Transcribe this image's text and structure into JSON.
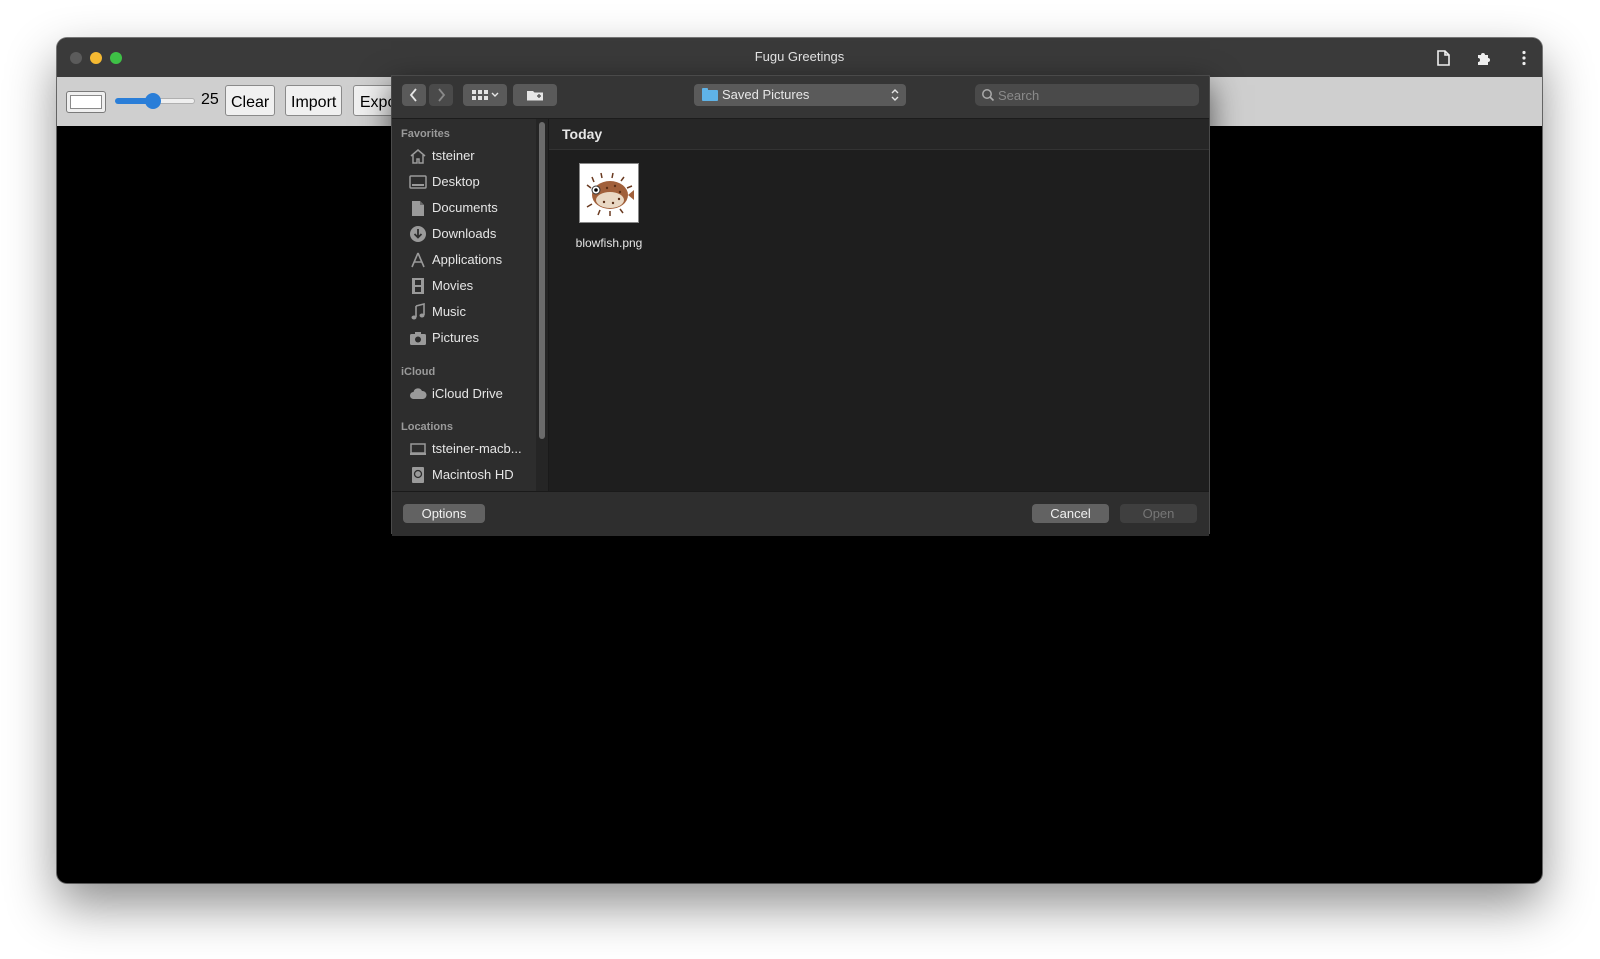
{
  "window": {
    "title": "Fugu Greetings"
  },
  "toolbar": {
    "color_value": "#ffffff",
    "brush_size_value": 25,
    "brush_size_label": "25",
    "clear_label": "Clear",
    "import_label": "Import",
    "export_label": "Export"
  },
  "dialog": {
    "location_label": "Saved Pictures",
    "search_placeholder": "Search",
    "sidebar": {
      "favorites_label": "Favorites",
      "favorites": [
        "tsteiner",
        "Desktop",
        "Documents",
        "Downloads",
        "Applications",
        "Movies",
        "Music",
        "Pictures"
      ],
      "icloud_label": "iCloud",
      "icloud": [
        "iCloud Drive"
      ],
      "locations_label": "Locations",
      "locations": [
        "tsteiner-macb...",
        "Macintosh HD"
      ]
    },
    "group_label": "Today",
    "files": [
      {
        "name": "blowfish.png"
      }
    ],
    "options_label": "Options",
    "cancel_label": "Cancel",
    "open_label": "Open"
  },
  "colors": {
    "accent_blue": "#2a7ed8",
    "folder_blue": "#5fb3e8",
    "traffic_yellow": "#f5b932",
    "traffic_green": "#3ec146"
  }
}
